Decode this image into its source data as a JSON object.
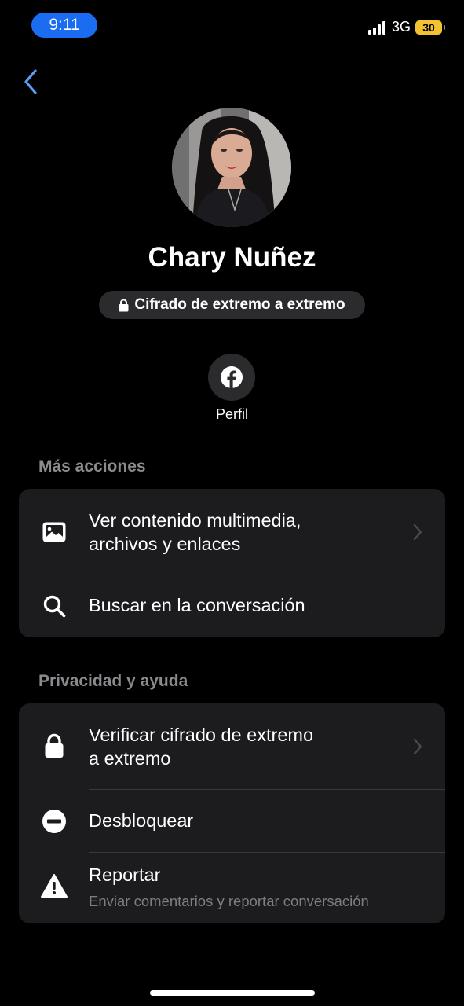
{
  "status_bar": {
    "time": "9:11",
    "network": "3G",
    "battery": "30"
  },
  "contact": {
    "name": "Chary Nuñez",
    "encryption_badge": "Cifrado de extremo a extremo"
  },
  "quick_actions": {
    "profile_label": "Perfil"
  },
  "sections": {
    "more_actions": {
      "title": "Más acciones",
      "media_label_line1": "Ver contenido multimedia,",
      "media_label_line2": "archivos y enlaces",
      "search_label": "Buscar en la conversación"
    },
    "privacy": {
      "title": "Privacidad y ayuda",
      "verify_label_line1": "Verificar cifrado de extremo",
      "verify_label_line2": "a extremo",
      "unblock_label": "Desbloquear",
      "report_label": "Reportar",
      "report_sublabel": "Enviar comentarios y reportar conversación"
    }
  },
  "icons": {
    "back": "chevron-left-icon",
    "lock": "lock-icon",
    "facebook": "facebook-icon",
    "media": "image-icon",
    "search": "search-icon",
    "unblock": "minus-circle-icon",
    "report": "warning-icon",
    "chevron": "chevron-right-icon"
  },
  "colors": {
    "background": "#000000",
    "card": "#1c1c1e",
    "accent_blue": "#1a6cf0",
    "back_chevron": "#5d9cf5",
    "section_title": "#8b8b8f",
    "battery": "#f1c232"
  }
}
